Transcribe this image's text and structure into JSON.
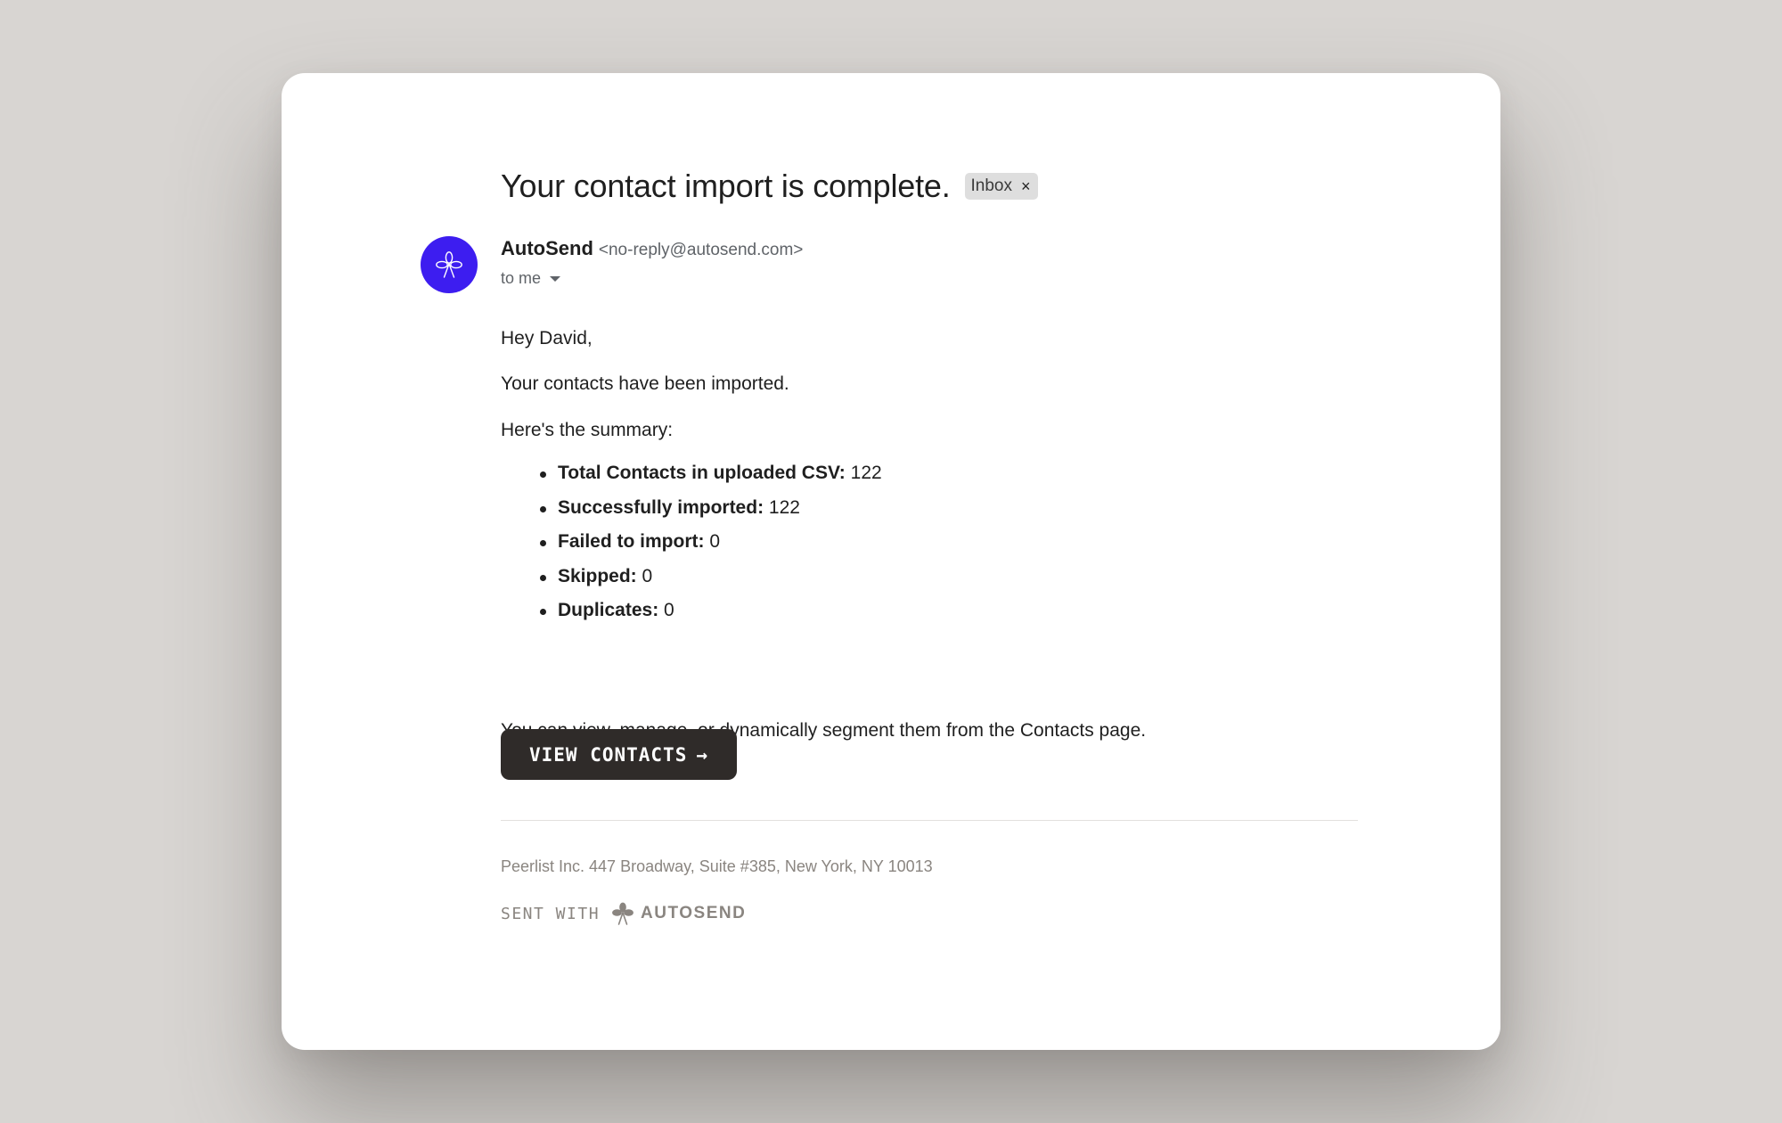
{
  "email": {
    "subject": "Your contact import is complete.",
    "label_chip": "Inbox",
    "label_remove_icon": "close-icon",
    "sender": {
      "name": "AutoSend",
      "email": "<no-reply@autosend.com>",
      "avatar_icon": "autosend-logo-icon",
      "avatar_color": "#3d1df0"
    },
    "recipient": "to me",
    "body": {
      "greeting": "Hey David,",
      "intro": "Your contacts have been imported.",
      "summary_intro": "Here's the summary:",
      "summary": [
        {
          "label": "Total Contacts in uploaded CSV:",
          "value": "122"
        },
        {
          "label": "Successfully imported:",
          "value": "122"
        },
        {
          "label": "Failed to import:",
          "value": "0"
        },
        {
          "label": "Skipped:",
          "value": "0"
        },
        {
          "label": "Duplicates:",
          "value": "0"
        }
      ],
      "closing": "You can view, manage, or dynamically segment them from the Contacts page."
    },
    "cta": {
      "label": "VIEW CONTACTS",
      "arrow": "→",
      "color": "#2f2b29"
    },
    "footer": {
      "address": "Peerlist Inc. 447 Broadway, Suite #385, New York, NY 10013",
      "sent_with": "SENT WITH",
      "brand": "AUTOSEND"
    }
  }
}
